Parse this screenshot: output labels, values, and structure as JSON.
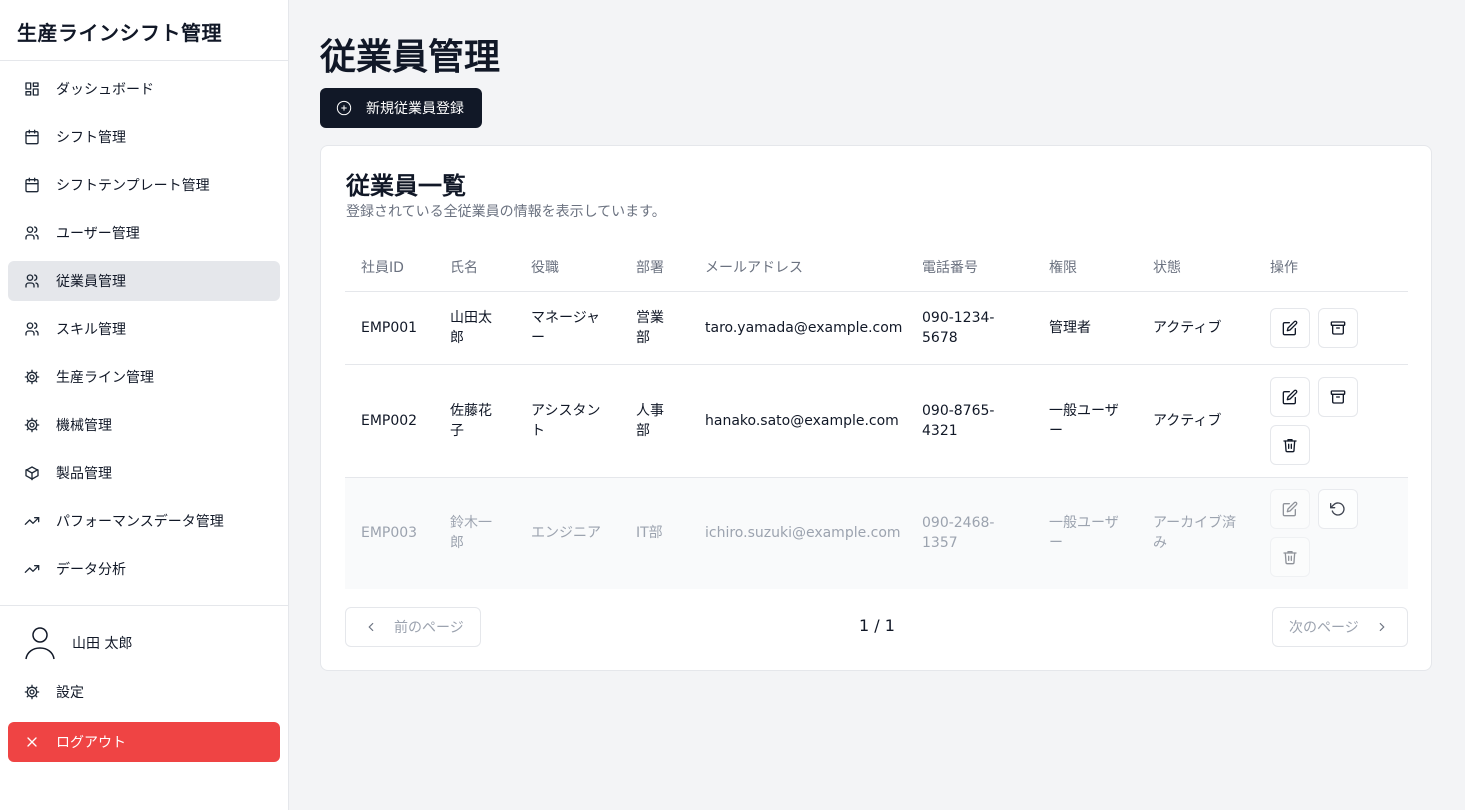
{
  "app": {
    "title": "生産ラインシフト管理"
  },
  "sidebar": {
    "items": [
      {
        "label": "ダッシュボード",
        "icon": "dashboard-icon"
      },
      {
        "label": "シフト管理",
        "icon": "calendar-icon"
      },
      {
        "label": "シフトテンプレート管理",
        "icon": "calendar-icon"
      },
      {
        "label": "ユーザー管理",
        "icon": "users-icon"
      },
      {
        "label": "従業員管理",
        "icon": "users-icon",
        "active": true
      },
      {
        "label": "スキル管理",
        "icon": "users-icon"
      },
      {
        "label": "生産ライン管理",
        "icon": "gear-icon"
      },
      {
        "label": "機械管理",
        "icon": "gear-icon"
      },
      {
        "label": "製品管理",
        "icon": "box-icon"
      },
      {
        "label": "パフォーマンスデータ管理",
        "icon": "trending-up-icon"
      },
      {
        "label": "データ分析",
        "icon": "trending-up-icon"
      }
    ],
    "user_name": "山田 太郎",
    "settings_label": "設定",
    "logout_label": "ログアウト"
  },
  "main": {
    "title": "従業員管理",
    "new_button": "新規従業員登録",
    "card": {
      "title": "従業員一覧",
      "description": "登録されている全従業員の情報を表示しています。"
    },
    "table": {
      "headers": [
        "社員ID",
        "氏名",
        "役職",
        "部署",
        "メールアドレス",
        "電話番号",
        "権限",
        "状態",
        "操作"
      ],
      "rows": [
        {
          "id": "EMP001",
          "name": "山田太郎",
          "position": "マネージャー",
          "dept": "営業部",
          "email": "taro.yamada@example.com",
          "phone": "090-1234-5678",
          "role": "管理者",
          "status": "アクティブ"
        },
        {
          "id": "EMP002",
          "name": "佐藤花子",
          "position": "アシスタント",
          "dept": "人事部",
          "email": "hanako.sato@example.com",
          "phone": "090-8765-4321",
          "role": "一般ユーザー",
          "status": "アクティブ"
        },
        {
          "id": "EMP003",
          "name": "鈴木一郎",
          "position": "エンジニア",
          "dept": "IT部",
          "email": "ichiro.suzuki@example.com",
          "phone": "090-2468-1357",
          "role": "一般ユーザー",
          "status": "アーカイブ済み"
        }
      ]
    },
    "pagination": {
      "prev": "前のページ",
      "next": "次のページ",
      "count": "1 / 1"
    }
  },
  "colors": {
    "primary": "#111827",
    "danger": "#ef4444",
    "active_bg": "#e5e7eb",
    "background": "#f3f4f6"
  }
}
